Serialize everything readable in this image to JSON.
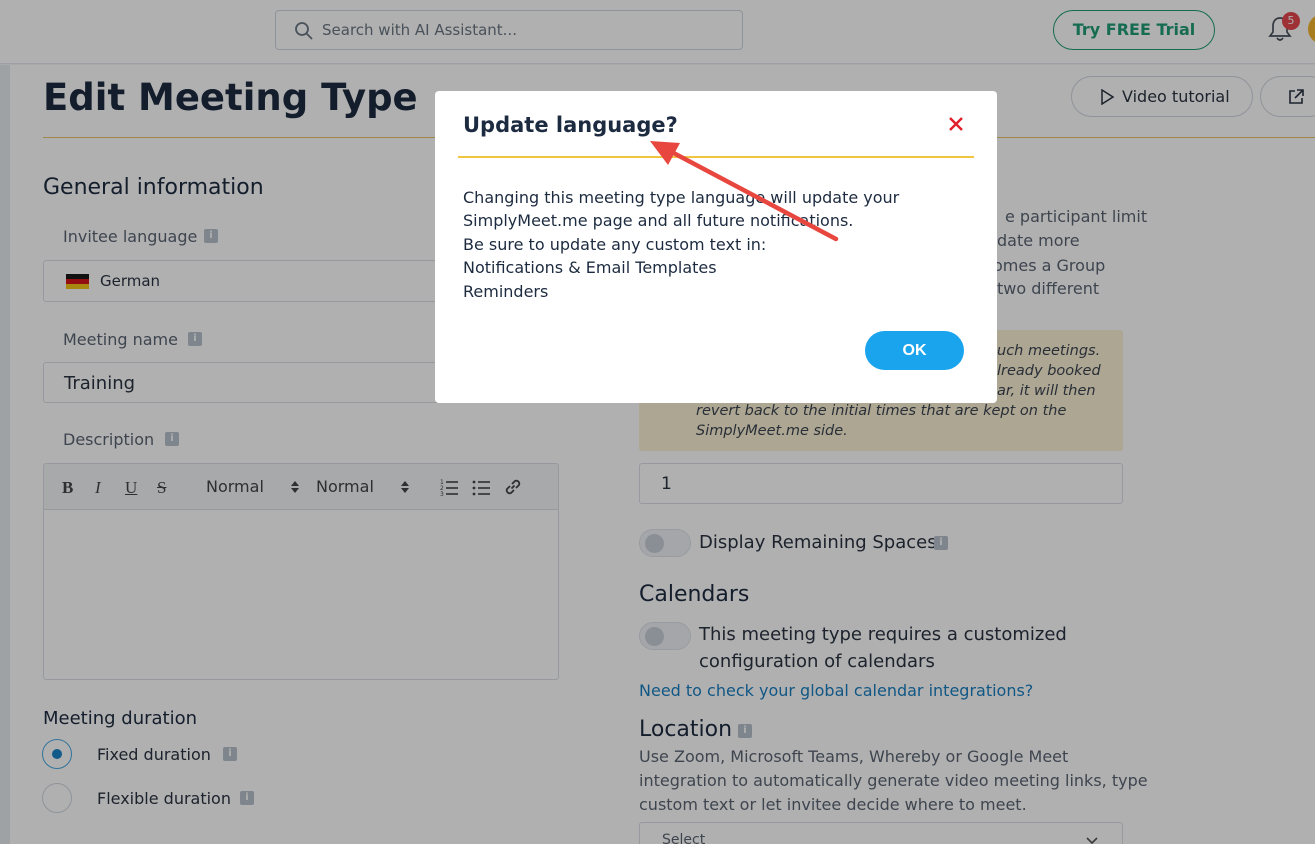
{
  "topbar": {
    "search_placeholder": "Search with AI Assistant...",
    "trial_label": "Try FREE Trial",
    "notification_count": "5"
  },
  "page": {
    "title": "Edit Meeting Type",
    "video_tutorial_label": "Video tutorial"
  },
  "general": {
    "section_title": "General information",
    "invitee_language_label": "Invitee language",
    "invitee_language_value": "German",
    "meeting_name_label": "Meeting name",
    "meeting_name_value": "Training",
    "description_label": "Description",
    "editor": {
      "bold": "B",
      "italic": "I",
      "underline": "U",
      "strike": "S",
      "font_size": "Normal",
      "heading": "Normal"
    },
    "duration_title": "Meeting duration",
    "duration_options": [
      {
        "label": "Fixed duration",
        "selected": true
      },
      {
        "label": "Flexible duration",
        "selected": false
      }
    ]
  },
  "right": {
    "intro_lines": [
      "e participant limit",
      "date more",
      "omes a Group",
      "two different"
    ],
    "warning_lines": [
      "uch meetings.",
      "lready booked",
      "ar, it will then",
      "revert back to the initial times that are kept on the",
      "SimplyMeet.me side."
    ],
    "participant_limit_value": "1",
    "remaining_spaces_label": "Display Remaining Spaces",
    "calendars_title": "Calendars",
    "calendars_toggle_lines": [
      "This meeting type requires a customized",
      "configuration of calendars"
    ],
    "calendars_link": "Need to check your global calendar integrations?",
    "location_title": "Location",
    "location_lines": [
      "Use Zoom, Microsoft Teams, Whereby or Google Meet",
      "integration to automatically generate video meeting links, type",
      "custom text or let invitee decide where to meet."
    ],
    "location_select_placeholder": "Select"
  },
  "modal": {
    "title": "Update language?",
    "lines": [
      "Changing this meeting type language will update your",
      "SimplyMeet.me page and all future notifications.",
      "Be sure to update any custom text in:",
      "Notifications & Email Templates",
      "Reminders"
    ],
    "ok_label": "OK"
  },
  "colors": {
    "accent_green": "#1f9d74",
    "ok_blue": "#1aa4ee",
    "close_red": "#e0202a",
    "arrow_red": "#e8473f",
    "rule_yellow": "#f0c540"
  }
}
